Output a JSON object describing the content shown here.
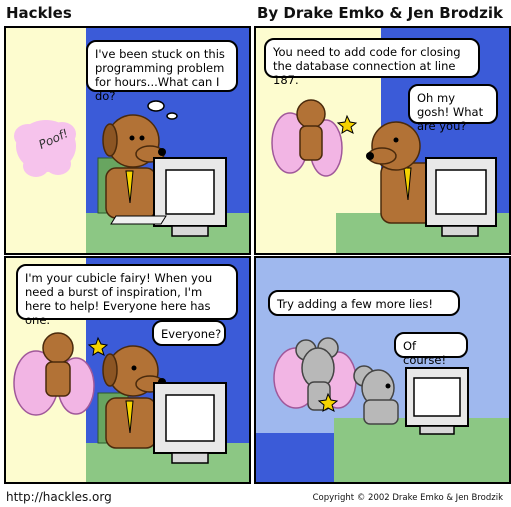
{
  "header": {
    "title": "Hackles",
    "authors": "By Drake Emko & Jen Brodzik"
  },
  "panels": [
    {
      "speech": [
        "I've been stuck on this programming problem for hours...What can I do?"
      ],
      "poof": "Poof!"
    },
    {
      "speech": [
        "You need to add code for closing the database connection at line 187.",
        "Oh my gosh! What are you?"
      ]
    },
    {
      "speech": [
        "I'm your cubicle fairy! When you need a burst of inspiration, I'm here to help! Everyone here has one.",
        "Everyone?"
      ]
    },
    {
      "speech": [
        "Try adding a few more lies!",
        "Of course!"
      ]
    }
  ],
  "footer": {
    "url": "http://hackles.org",
    "copyright": "Copyright © 2002 Drake Emko & Jen Brodzik"
  },
  "colors": {
    "wall": "#fdfccf",
    "blue_wall": "#3b5bd8",
    "light_blue": "#9fb8ee",
    "dog": "#b27236",
    "desk": "#8cc784",
    "fairy_wing": "#f2b5e4",
    "poof": "#f6c3ec"
  }
}
